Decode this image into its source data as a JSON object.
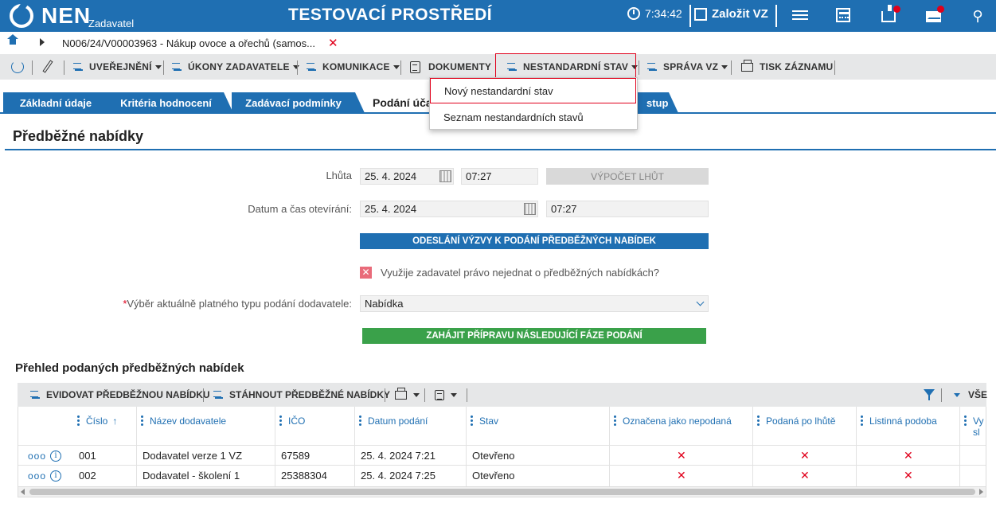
{
  "header": {
    "logo_text": "NEN",
    "logo_sub": "Zadavatel",
    "env_title": "TESTOVACÍ PROSTŘEDÍ",
    "time": "7:34:42",
    "create_vz": "Založit VZ"
  },
  "breadcrumb": {
    "text": "N006/24/V00003963 - Nákup ovoce a ořechů (samos..."
  },
  "toolbar": {
    "uverejneni": "UVEŘEJNĚNÍ",
    "ukony": "ÚKONY ZADAVATELE",
    "komunikace": "KOMUNIKACE",
    "dokumenty": "DOKUMENTY",
    "nestandardni": "NESTANDARDNÍ STAV",
    "sprava": "SPRÁVA VZ",
    "tisk": "TISK ZÁZNAMU"
  },
  "tabs": {
    "t1": "Základní údaje",
    "t2": "Kritéria hodnocení",
    "t3": "Zadávací podmínky",
    "t4": "Podání úča",
    "t5": "stupu"
  },
  "dropdown": {
    "item1": "Nový nestandardní stav",
    "item2": "Seznam nestandardních stavů"
  },
  "section": {
    "title": "Předběžné nabídky"
  },
  "form": {
    "lhuta_label": "Lhůta",
    "lhuta_date": "25. 4. 2024",
    "lhuta_time": "07:27",
    "vypocet_btn": "VÝPOČET LHŮT",
    "otevirani_label": "Datum a čas otevírání:",
    "otevirani_date": "25. 4. 2024",
    "otevirani_time": "07:27",
    "odeslani_btn": "ODESLÁNÍ VÝZVY K PODÁNÍ PŘEDBĚŽNÝCH NABÍDEK",
    "checkbox_label": "Využije zadavatel právo nejednat o předběžných nabídkách?",
    "vyber_label": "Výběr aktuálně platného typu podání dodavatele:",
    "vyber_value": "Nabídka",
    "zahajit_btn": "ZAHÁJIT PŘÍPRAVU NÁSLEDUJÍCÍ FÁZE PODÁNÍ"
  },
  "grid": {
    "title": "Přehled podaných předběžných nabídek",
    "evidovat": "EVIDOVAT PŘEDBĚŽNOU NABÍDKU",
    "stahnout": "STÁHNOUT PŘEDBĚŽNÉ NABÍDKY",
    "vse": "VŠE",
    "columns": {
      "cislo": "Číslo",
      "nazev": "Název dodavatele",
      "ico": "IČO",
      "datum": "Datum podání",
      "stav": "Stav",
      "nepodana": "Označena jako nepodaná",
      "polhute": "Podaná po lhůtě",
      "listinna": "Listinná podoba",
      "vy": "Vy sl"
    },
    "rows": [
      {
        "cislo": "001",
        "nazev": "Dodavatel verze 1 VZ",
        "ico": "67589",
        "datum": "25. 4. 2024 7:21",
        "stav": "Otevřeno"
      },
      {
        "cislo": "002",
        "nazev": "Dodavatel - školení 1",
        "ico": "25388304",
        "datum": "25. 4. 2024 7:25",
        "stav": "Otevřeno"
      }
    ]
  },
  "colors": {
    "brand_blue": "#1f6fb2",
    "alert_red": "#e0001b",
    "action_green": "#3aa14a"
  }
}
